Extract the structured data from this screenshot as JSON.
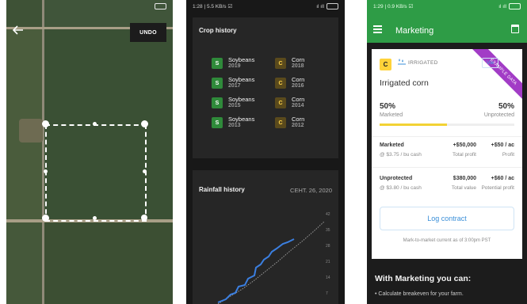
{
  "map_screen": {
    "status_time": "",
    "back_icon": "arrow-left-icon",
    "undo_label": "UNDO"
  },
  "crop_screen": {
    "status_time": "1:28 | 5.5 KB/s ☑",
    "status_signal": "ıl ıll",
    "battery": "",
    "crop_history_title": "Crop history",
    "crops": [
      {
        "badge": "S",
        "name": "Soybeans",
        "year": "2019"
      },
      {
        "badge": "C",
        "name": "Corn",
        "year": "2018"
      },
      {
        "badge": "S",
        "name": "Soybeans",
        "year": "2017"
      },
      {
        "badge": "C",
        "name": "Corn",
        "year": "2016"
      },
      {
        "badge": "S",
        "name": "Soybeans",
        "year": "2015"
      },
      {
        "badge": "C",
        "name": "Corn",
        "year": "2014"
      },
      {
        "badge": "S",
        "name": "Soybeans",
        "year": "2013"
      },
      {
        "badge": "C",
        "name": "Corn",
        "year": "2012"
      }
    ],
    "rainfall_title": "Rainfall history",
    "rainfall_date": "CEHT. 26, 2020",
    "rainfall_axis_ticks": [
      "42",
      "35",
      "28",
      "21",
      "14",
      "7"
    ]
  },
  "marketing_screen": {
    "status_time": "1:29 | 0.9 KB/s ☑",
    "status_signal": "ıl ıll",
    "battery": "",
    "menu_icon": "hamburger-menu-icon",
    "title": "Marketing",
    "calendar_icon": "calendar-icon",
    "ribbon": "EXAMPLE DATA",
    "crop_badge": "C",
    "irrigated_label": "IRRIGATED",
    "view_label": "Vie",
    "card_title": "Irrigated corn",
    "marketed_pct": "50%",
    "marketed_label": "Marketed",
    "unprotected_pct": "50%",
    "unprotected_label": "Unprotected",
    "marketed_fraction": 0.5,
    "rows": [
      {
        "label": "Marketed",
        "sub": "@ $3.75 / bu cash",
        "v1": "+$50,000",
        "v1_sub": "Total profit",
        "v2": "+$50 / ac",
        "v2_sub": "Profit"
      },
      {
        "label": "Unprotected",
        "sub": "@ $3.80 / bu cash",
        "v1": "$380,000",
        "v1_sub": "Total value",
        "v2": "+$60 / ac",
        "v2_sub": "Potential profit"
      }
    ],
    "log_contract_label": "Log contract",
    "mark_to_market": "Mark-to-market current as of 3:00pm PST",
    "with_marketing_title": "With Marketing you can:",
    "bullet_1": "• Calculate breakeven for your farm."
  },
  "colors": {
    "green_appbar": "#2e9c46",
    "soy_badge": "#2f8a3a",
    "corn_badge": "#ffd33a",
    "ribbon": "#a23cc6",
    "rain_current": "#3b7fe0"
  }
}
